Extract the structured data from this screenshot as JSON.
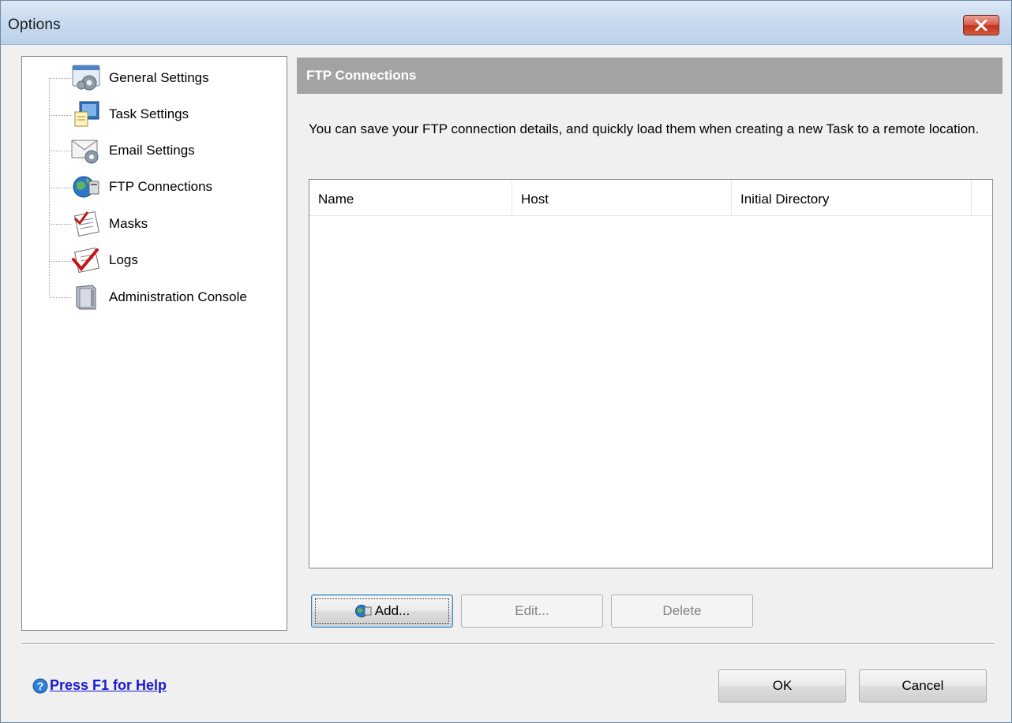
{
  "window": {
    "title": "Options"
  },
  "tree": {
    "items": [
      {
        "label": "General Settings",
        "icon": "settings-gear-icon"
      },
      {
        "label": "Task Settings",
        "icon": "task-monitor-icon"
      },
      {
        "label": "Email Settings",
        "icon": "email-gear-icon"
      },
      {
        "label": "FTP Connections",
        "icon": "ftp-globe-icon"
      },
      {
        "label": "Masks",
        "icon": "masks-icon"
      },
      {
        "label": "Logs",
        "icon": "logs-check-icon"
      },
      {
        "label": "Administration Console",
        "icon": "admin-console-icon"
      }
    ],
    "selected": "FTP Connections"
  },
  "main": {
    "header": "FTP Connections",
    "description": "You can save your FTP connection details, and quickly load them when creating a new Task to a remote location.",
    "list": {
      "columns": [
        "Name",
        "Host",
        "Initial Directory"
      ],
      "rows": []
    },
    "buttons": {
      "add": "Add...",
      "edit": "Edit...",
      "delete": "Delete"
    }
  },
  "footer": {
    "help": "Press F1 for Help",
    "ok": "OK",
    "cancel": "Cancel"
  },
  "colors": {
    "header_bg": "#a3a3a3",
    "link": "#1a1ad0",
    "close_button": "#c2331f"
  }
}
